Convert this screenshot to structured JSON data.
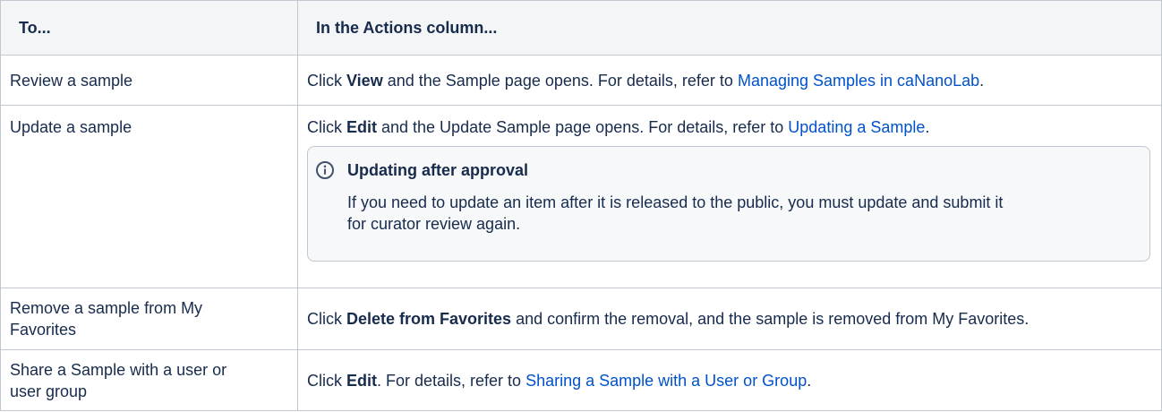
{
  "colors": {
    "text": "#172b4d",
    "link": "#0052cc",
    "header_bg": "#f4f5f7",
    "border": "#c1c7d0",
    "panel_bg": "#f7f8f9",
    "panel_border": "#c1c7d0",
    "icon": "#42526e"
  },
  "table": {
    "headers": [
      "To...",
      "In the Actions column..."
    ],
    "rows": [
      {
        "task": "Review a sample",
        "action": {
          "prefix": "Click ",
          "bold": "View",
          "middle": " and the Sample page opens. For details, refer to ",
          "link": "Managing Samples in caNanoLab",
          "suffix": "."
        }
      },
      {
        "task": "Update a sample",
        "action": {
          "prefix": "Click ",
          "bold": "Edit",
          "middle": " and the Update Sample page opens. For details, refer to ",
          "link": "Updating a Sample",
          "suffix": "."
        },
        "panel": {
          "icon": "info-icon",
          "title": "Updating after approval",
          "body": "If you need to update an item after it is released to the public, you must update and submit it for curator review again."
        }
      },
      {
        "task": "Remove a sample from My Favorites",
        "action": {
          "prefix": "Click ",
          "bold": "Delete from Favorites",
          "middle": " and confirm the removal, and the sample is removed from My Favorites."
        }
      },
      {
        "task": "Share a Sample with a user or user group",
        "action": {
          "prefix": "Click ",
          "bold": "Edit",
          "middle": ". For details, refer to ",
          "link": "Sharing a Sample with a User or Group",
          "suffix": "."
        }
      }
    ]
  }
}
